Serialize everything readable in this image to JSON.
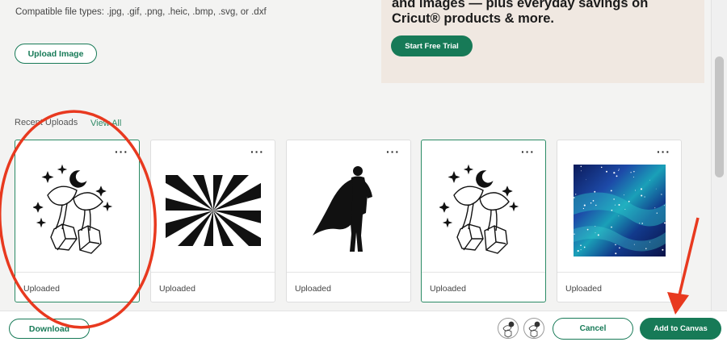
{
  "upload": {
    "compatible_types": "Compatible file types: .jpg, .gif, .png, .heic, .bmp, .svg, or .dxf",
    "upload_button": "Upload Image"
  },
  "promo": {
    "text": "and images — plus everyday savings on Cricut® products & more.",
    "trial_button": "Start Free Trial",
    "background": "#f0e8e1"
  },
  "recent": {
    "label": "Recent Uploads",
    "view_all": "View All",
    "items": [
      {
        "label": "Uploaded",
        "image": "mushroom-crystal-moon-line-art",
        "selected": true
      },
      {
        "label": "Uploaded",
        "image": "sunburst-rays-black-white",
        "selected": false
      },
      {
        "label": "Uploaded",
        "image": "superhero-cape-silhouette",
        "selected": false
      },
      {
        "label": "Uploaded",
        "image": "mushroom-crystal-moon-line-art",
        "selected": true
      },
      {
        "label": "Uploaded",
        "image": "galaxy-starfield-blue",
        "selected": false
      }
    ],
    "more_icon": "more-horizontal-icon"
  },
  "footer": {
    "download_button": "Download",
    "cancel_button": "Cancel",
    "add_to_canvas_button": "Add to Canvas"
  },
  "colors": {
    "accent": "#177a57",
    "annotation_red": "#e8391f"
  }
}
